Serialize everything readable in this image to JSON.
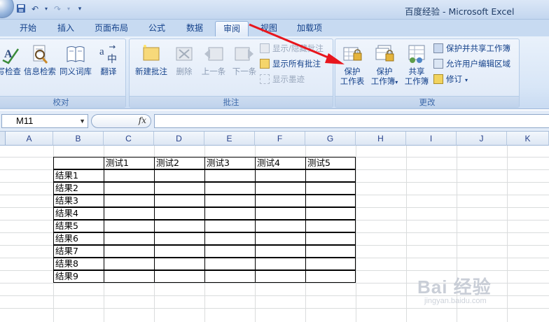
{
  "window": {
    "title": "百度经验 - Microsoft Excel"
  },
  "tabs": [
    "开始",
    "插入",
    "页面布局",
    "公式",
    "数据",
    "审阅",
    "视图",
    "加载项"
  ],
  "active_tab": "审阅",
  "ribbon": {
    "proofing": {
      "label": "校对",
      "spell_check": "拼写检查",
      "research": "信息检索",
      "thesaurus": "同义词库",
      "translate": "翻译"
    },
    "comments": {
      "label": "批注",
      "new_comment": "新建批注",
      "delete": "删除",
      "previous": "上一条",
      "next": "下一条",
      "show_hide": "显示/隐藏批注",
      "show_all": "显示所有批注",
      "show_ink": "显示墨迹"
    },
    "changes": {
      "label": "更改",
      "protect_sheet_1": "保护",
      "protect_sheet_2": "工作表",
      "protect_workbook_1": "保护",
      "protect_workbook_2": "工作簿",
      "share_workbook_1": "共享",
      "share_workbook_2": "工作簿",
      "protect_share": "保护并共享工作簿",
      "allow_edit_ranges": "允许用户编辑区域",
      "track_changes": "修订"
    }
  },
  "formula_bar": {
    "name_box": "M11",
    "fx": "fx",
    "content": ""
  },
  "columns": [
    "A",
    "B",
    "C",
    "D",
    "E",
    "F",
    "G",
    "H",
    "I",
    "J",
    "K"
  ],
  "table": {
    "headers": [
      "测试1",
      "测试2",
      "测试3",
      "测试4",
      "测试5"
    ],
    "rows": [
      "结果1",
      "结果2",
      "结果3",
      "结果4",
      "结果5",
      "结果6",
      "结果7",
      "结果8",
      "结果9"
    ]
  },
  "watermark": {
    "main": "Bai 经验",
    "sub": "jingyan.baidu.com"
  },
  "colors": {
    "annotation_arrow": "#e8161d",
    "ribbon": "#dbe7f7"
  }
}
